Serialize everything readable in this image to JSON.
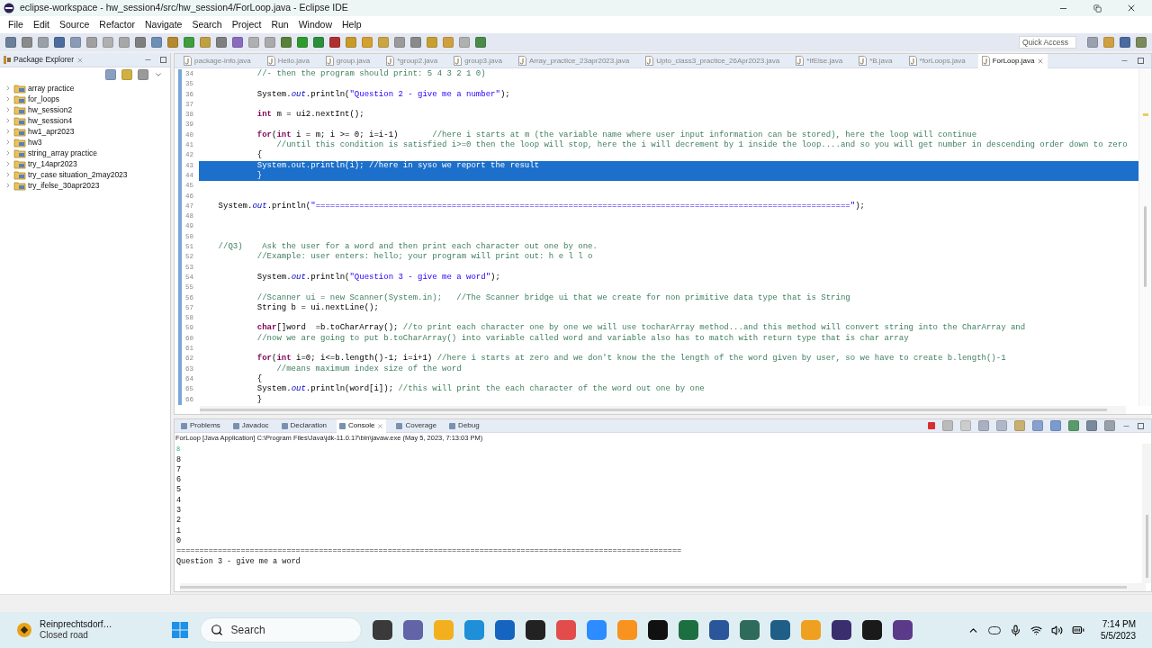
{
  "window": {
    "title": "eclipse-workspace - hw_session4/src/hw_session4/ForLoop.java - Eclipse IDE"
  },
  "menu": [
    "File",
    "Edit",
    "Source",
    "Refactor",
    "Navigate",
    "Search",
    "Project",
    "Run",
    "Window",
    "Help"
  ],
  "quick_access": {
    "placeholder": "Quick Access"
  },
  "package_explorer": {
    "title": "Package Explorer",
    "items": [
      {
        "label": "array practice",
        "expanded": false
      },
      {
        "label": "for_loops",
        "expanded": false
      },
      {
        "label": "hw_session2",
        "expanded": false
      },
      {
        "label": "hw_session4",
        "expanded": false
      },
      {
        "label": "hw1_apr2023",
        "expanded": false
      },
      {
        "label": "hw3",
        "expanded": false
      },
      {
        "label": "string_array practice",
        "expanded": false
      },
      {
        "label": "try_14apr2023",
        "expanded": false
      },
      {
        "label": "try_case situation_2may2023",
        "expanded": false
      },
      {
        "label": "try_ifelse_30apr2023",
        "expanded": false
      }
    ]
  },
  "editor": {
    "tabs": [
      {
        "label": "package-info.java",
        "selected": false
      },
      {
        "label": "Hello.java",
        "selected": false
      },
      {
        "label": "group.java",
        "selected": false
      },
      {
        "label": "*group2.java",
        "selected": false
      },
      {
        "label": "group3.java",
        "selected": false
      },
      {
        "label": "Array_practice_23apr2023.java",
        "selected": false
      },
      {
        "label": "Upto_class3_practice_26Apr2023.java",
        "selected": false
      },
      {
        "label": "*IfElse.java",
        "selected": false
      },
      {
        "label": "*B.java",
        "selected": false
      },
      {
        "label": "*forLoops.java",
        "selected": false
      },
      {
        "label": "ForLoop.java",
        "selected": true
      }
    ],
    "lines": [
      {
        "number": "34",
        "selected": false,
        "parts": [
          {
            "kind": "comment",
            "text": "            //- then the program should print: 5 4 3 2 1 0)"
          }
        ]
      },
      {
        "number": "35",
        "selected": false
      },
      {
        "number": "36",
        "selected": false,
        "parts": [
          {
            "kind": "code",
            "text": "            System."
          },
          {
            "kind": "field",
            "text": "out"
          },
          {
            "kind": "code",
            "text": ".println("
          },
          {
            "kind": "string",
            "text": "\"Question 2 - give me a number\""
          },
          {
            "kind": "code",
            "text": ");"
          }
        ]
      },
      {
        "number": "37",
        "selected": false
      },
      {
        "number": "38",
        "selected": false,
        "parts": [
          {
            "kind": "keyword",
            "text": "            int"
          },
          {
            "kind": "code",
            "text": " m = ui2.nextInt();"
          }
        ]
      },
      {
        "number": "39",
        "selected": false
      },
      {
        "number": "40",
        "selected": false,
        "parts": [
          {
            "kind": "keyword",
            "text": "            for"
          },
          {
            "kind": "code",
            "text": "("
          },
          {
            "kind": "keyword",
            "text": "int"
          },
          {
            "kind": "code",
            "text": " i = m; i >= 0; i=i-1)       "
          },
          {
            "kind": "comment",
            "text": "//here i starts at m (the variable name where user input information can be stored), here the loop will continue"
          }
        ]
      },
      {
        "number": "41",
        "selected": false,
        "parts": [
          {
            "kind": "comment",
            "text": "                //until this condition is satisfied i>=0 then the loop will stop, here the i will decrement by 1 inside the loop....and so you will get number in descending order down to zero"
          }
        ]
      },
      {
        "number": "42",
        "selected": false,
        "parts": [
          {
            "kind": "code",
            "text": "            {"
          }
        ]
      },
      {
        "number": "43",
        "selected": true,
        "parts": [
          {
            "kind": "code",
            "text": "            System.out.println(i); //here in syso we report the result"
          }
        ]
      },
      {
        "number": "44",
        "selected": true,
        "parts": [
          {
            "kind": "code",
            "text": "            }"
          }
        ]
      },
      {
        "number": "45",
        "selected": false
      },
      {
        "number": "46",
        "selected": false
      },
      {
        "number": "47",
        "selected": false,
        "parts": [
          {
            "kind": "code",
            "text": "    System."
          },
          {
            "kind": "field",
            "text": "out"
          },
          {
            "kind": "code",
            "text": ".println("
          },
          {
            "kind": "string",
            "text": "\"==============================================================================================================\""
          },
          {
            "kind": "code",
            "text": ");"
          }
        ]
      },
      {
        "number": "48",
        "selected": false
      },
      {
        "number": "49",
        "selected": false
      },
      {
        "number": "50",
        "selected": false
      },
      {
        "number": "51",
        "selected": false,
        "parts": [
          {
            "kind": "comment",
            "text": "    //Q3)    Ask the user for a word and then print each character out one by one."
          }
        ]
      },
      {
        "number": "52",
        "selected": false,
        "parts": [
          {
            "kind": "comment",
            "text": "            //Example: user enters: hello; your program will print out: h e l l o"
          }
        ]
      },
      {
        "number": "53",
        "selected": false
      },
      {
        "number": "54",
        "selected": false,
        "parts": [
          {
            "kind": "code",
            "text": "            System."
          },
          {
            "kind": "field",
            "text": "out"
          },
          {
            "kind": "code",
            "text": ".println("
          },
          {
            "kind": "string",
            "text": "\"Question 3 - give me a word\""
          },
          {
            "kind": "code",
            "text": ");"
          }
        ]
      },
      {
        "number": "55",
        "selected": false
      },
      {
        "number": "56",
        "selected": false,
        "parts": [
          {
            "kind": "comment",
            "text": "            //Scanner ui = new Scanner(System.in);   //The Scanner bridge ui that we create for non primitive data type that is String"
          }
        ]
      },
      {
        "number": "57",
        "selected": false,
        "parts": [
          {
            "kind": "code",
            "text": "            String b = ui.nextLine();"
          }
        ]
      },
      {
        "number": "58",
        "selected": false
      },
      {
        "number": "59",
        "selected": false,
        "parts": [
          {
            "kind": "keyword",
            "text": "            char"
          },
          {
            "kind": "code",
            "text": "[]word  =b.toCharArray(); "
          },
          {
            "kind": "comment",
            "text": "//to print each character one by one we will use tocharArray method...and this method will convert string into the CharArray and"
          }
        ]
      },
      {
        "number": "60",
        "selected": false,
        "parts": [
          {
            "kind": "comment",
            "text": "            //now we are going to put b.toCharArray() into variable called word and variable also has to match with return type that is char array"
          }
        ]
      },
      {
        "number": "61",
        "selected": false
      },
      {
        "number": "62",
        "selected": false,
        "parts": [
          {
            "kind": "keyword",
            "text": "            for"
          },
          {
            "kind": "code",
            "text": "("
          },
          {
            "kind": "keyword",
            "text": "int"
          },
          {
            "kind": "code",
            "text": " i=0; i<=b.length()-1; i=i+1) "
          },
          {
            "kind": "comment",
            "text": "//here i starts at zero and we don't know the the length of the word given by user, so we have to create b.length()-1"
          }
        ]
      },
      {
        "number": "63",
        "selected": false,
        "parts": [
          {
            "kind": "comment",
            "text": "                //means maximum index size of the word"
          }
        ]
      },
      {
        "number": "64",
        "selected": false,
        "parts": [
          {
            "kind": "code",
            "text": "            {"
          }
        ]
      },
      {
        "number": "65",
        "selected": false,
        "parts": [
          {
            "kind": "code",
            "text": "            System."
          },
          {
            "kind": "field",
            "text": "out"
          },
          {
            "kind": "code",
            "text": ".println(word[i]); "
          },
          {
            "kind": "comment",
            "text": "//this will print the each character of the word out one by one"
          }
        ]
      },
      {
        "number": "66",
        "selected": false,
        "parts": [
          {
            "kind": "code",
            "text": "            }"
          }
        ]
      }
    ]
  },
  "console_panel": {
    "tabs": [
      {
        "label": "Problems",
        "selected": false
      },
      {
        "label": "Javadoc",
        "selected": false
      },
      {
        "label": "Declaration",
        "selected": false
      },
      {
        "label": "Console",
        "selected": true
      },
      {
        "label": "Coverage",
        "selected": false
      },
      {
        "label": "Debug",
        "selected": false
      }
    ],
    "header": "ForLoop [Java Application] C:\\Program Files\\Java\\jdk-11.0.17\\bin\\javaw.exe (May 5, 2023, 7:13:03 PM)",
    "lines": [
      {
        "kind": "input",
        "text": "8"
      },
      {
        "kind": "output",
        "text": "8"
      },
      {
        "kind": "output",
        "text": "7"
      },
      {
        "kind": "output",
        "text": "6"
      },
      {
        "kind": "output",
        "text": "5"
      },
      {
        "kind": "output",
        "text": "4"
      },
      {
        "kind": "output",
        "text": "3"
      },
      {
        "kind": "output",
        "text": "2"
      },
      {
        "kind": "output",
        "text": "1"
      },
      {
        "kind": "output",
        "text": "0"
      },
      {
        "kind": "output",
        "text": "=============================================================================================================="
      },
      {
        "kind": "output",
        "text": "Question 3 - give me a word"
      }
    ]
  },
  "taskbar": {
    "weather": {
      "title": "Reinprechtsdorf…",
      "subtitle": "Closed road"
    },
    "search": {
      "placeholder": "Search"
    },
    "time": "7:14 PM",
    "date": "5/5/2023"
  }
}
